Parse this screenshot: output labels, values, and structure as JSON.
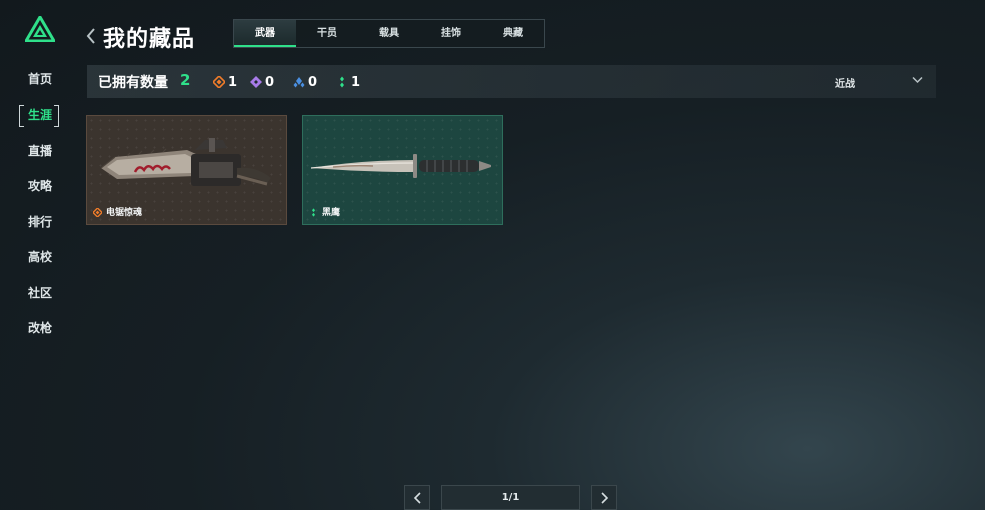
{
  "sidebar": {
    "items": [
      {
        "label": "首页"
      },
      {
        "label": "生涯"
      },
      {
        "label": "直播"
      },
      {
        "label": "攻略"
      },
      {
        "label": "排行"
      },
      {
        "label": "高校"
      },
      {
        "label": "社区"
      },
      {
        "label": "改枪"
      }
    ],
    "active_index": 1
  },
  "header": {
    "title": "我的藏品",
    "tabs": [
      {
        "label": "武器"
      },
      {
        "label": "干员"
      },
      {
        "label": "载具"
      },
      {
        "label": "挂饰"
      },
      {
        "label": "典藏"
      }
    ],
    "active_tab": 0
  },
  "stats": {
    "owned_label": "已拥有数量",
    "owned_count": "2",
    "rarities": [
      {
        "icon": "orange-rarity-icon",
        "color": "#f07c2a",
        "count": "1"
      },
      {
        "icon": "purple-rarity-icon",
        "color": "#a77be8",
        "count": "0"
      },
      {
        "icon": "blue-rarity-icon",
        "color": "#4a8fe0",
        "count": "0"
      },
      {
        "icon": "green-rarity-icon",
        "color": "#2fe08a",
        "count": "1"
      }
    ],
    "filter": {
      "selected": "近战"
    }
  },
  "items": [
    {
      "name": "电锯惊魂",
      "rarity": "orange",
      "icon": "chainsaw-image"
    },
    {
      "name": "黑鹰",
      "rarity": "green",
      "icon": "knife-image"
    }
  ],
  "pagination": {
    "display": "1/1"
  },
  "colors": {
    "accent": "#2fe08a",
    "orange": "#f07c2a",
    "purple": "#a77be8",
    "blue": "#4a8fe0"
  }
}
